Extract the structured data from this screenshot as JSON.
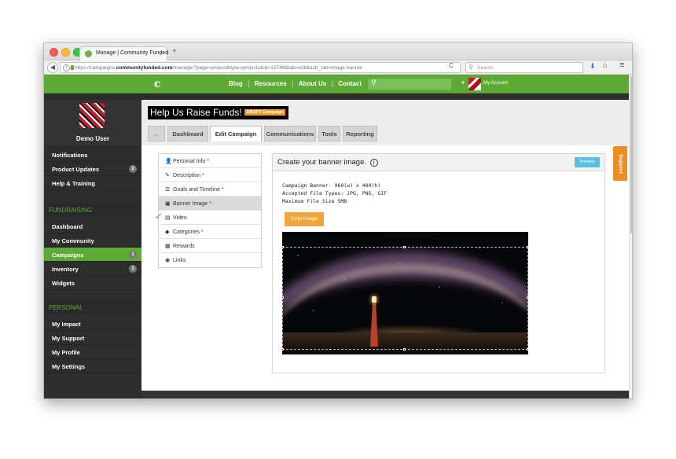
{
  "browser": {
    "tab_title": "Manage | Community Funded",
    "tab_close": "×",
    "new_tab": "+",
    "back": "◀",
    "url_prefix": "https://campaigns.",
    "url_domain": "communityfunded.com",
    "url_rest": "/manage/?page=project&type=projects&id=12748&tab=edit&sub_tab=image-banner",
    "reload": "C",
    "search_placeholder": "Search",
    "download_icon": "download-icon",
    "home_icon": "home-icon",
    "menu_icon": "hamburger-menu-icon"
  },
  "site_nav": {
    "logo": "c",
    "links": [
      "Blog",
      "Resources",
      "About Us",
      "Contact"
    ],
    "account_label": "My Account"
  },
  "sidebar": {
    "user_name": "Demo User",
    "top_items": [
      {
        "label": "Notifications",
        "badge": ""
      },
      {
        "label": "Product Updates",
        "badge": "2"
      },
      {
        "label": "Help & Training",
        "badge": ""
      }
    ],
    "fundraising_title": "FUNDRAISING",
    "fundraising_items": [
      {
        "label": "Dashboard",
        "badge": ""
      },
      {
        "label": "My Community",
        "badge": ""
      },
      {
        "label": "Campaigns",
        "badge": "1",
        "active": true
      },
      {
        "label": "Inventory",
        "badge": "1"
      },
      {
        "label": "Widgets",
        "badge": ""
      }
    ],
    "personal_title": "PERSONAL",
    "personal_items": [
      {
        "label": "My Impact"
      },
      {
        "label": "My Support"
      },
      {
        "label": "My Profile"
      },
      {
        "label": "My Settings"
      }
    ]
  },
  "header": {
    "title": "Help Us Raise Funds!",
    "draft_badge": "DRAFT Campaign",
    "tabs": [
      "Dashboard",
      "Edit Campaign",
      "Communications",
      "Tools",
      "Reporting"
    ],
    "active_tab": "Edit Campaign",
    "back_arrow": "←"
  },
  "subnav": {
    "items": [
      {
        "label": "Personal Info",
        "required": true,
        "icon": "user-icon"
      },
      {
        "label": "Description",
        "required": true,
        "icon": "pencil-icon"
      },
      {
        "label": "Goals and Timeline",
        "required": true,
        "icon": "list-icon"
      },
      {
        "label": "Banner Image",
        "required": true,
        "icon": "image-icon",
        "active": true
      },
      {
        "label": "Video",
        "required": false,
        "icon": "film-icon",
        "completed": true
      },
      {
        "label": "Categories",
        "required": true,
        "icon": "tags-icon"
      },
      {
        "label": "Rewards",
        "required": false,
        "icon": "grid-icon"
      },
      {
        "label": "Links",
        "required": false,
        "icon": "globe-icon"
      }
    ],
    "required_mark": "*",
    "check_mark": "✓"
  },
  "panel": {
    "title": "Create your banner image.",
    "info_icon": "i",
    "preview_label": "Preview",
    "spec_lines": [
      "Campaign Banner- 960(w) x 400(h)",
      "Accepted File Types: JPG, PNG, GIF",
      "Maximum File Size 5MB"
    ],
    "crop_label": "Crop Image"
  },
  "support_tab": "Support",
  "colors": {
    "brand_green": "#5daa35",
    "sidebar_bg": "#2d2d2d",
    "draft_orange": "#f29c1f",
    "support_orange": "#ef8b1f",
    "preview_blue": "#5bc0de",
    "crop_orange": "#f0a63c"
  }
}
